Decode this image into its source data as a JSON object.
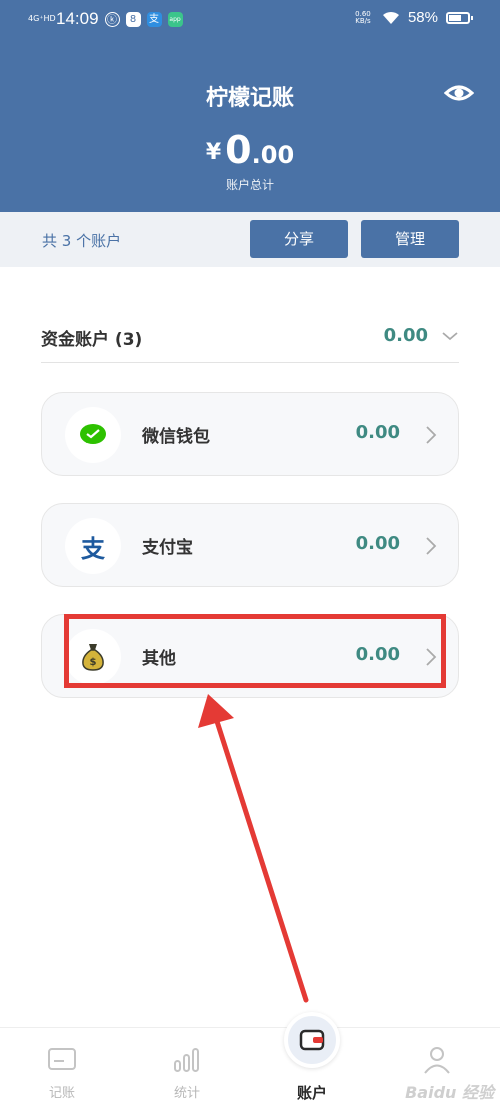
{
  "status_bar": {
    "network": "4G⁺HD",
    "time": "14:09",
    "speed": "0.60 KB/s",
    "battery": "58%",
    "battery_level": 0.58
  },
  "header": {
    "title": "柠檬记账",
    "currency_symbol": "¥",
    "total_int": "0",
    "total_dec": ".00",
    "total_label": "账户总计"
  },
  "subbar": {
    "count_text": "共 3 个账户",
    "share_label": "分享",
    "manage_label": "管理"
  },
  "section": {
    "title": "资金账户 (3)",
    "value": "0.00"
  },
  "accounts": [
    {
      "name": "微信钱包",
      "value": "0.00",
      "icon": "wechat-icon",
      "color": "#2dc100"
    },
    {
      "name": "支付宝",
      "value": "0.00",
      "icon": "alipay-icon",
      "color": "#1e5a9e"
    },
    {
      "name": "其他",
      "value": "0.00",
      "icon": "money-bag-icon",
      "color": "#c8a12c"
    }
  ],
  "colors": {
    "primary": "#4a72a6",
    "value": "#3f8a82",
    "annotation": "#e43a35"
  },
  "tabs": [
    {
      "label": "记账",
      "icon": "card-icon"
    },
    {
      "label": "统计",
      "icon": "bar-chart-icon"
    },
    {
      "label": "账户",
      "icon": "wallet-icon",
      "active": true
    },
    {
      "label": "",
      "icon": "profile-icon"
    }
  ],
  "watermark": "Baidu 经验"
}
